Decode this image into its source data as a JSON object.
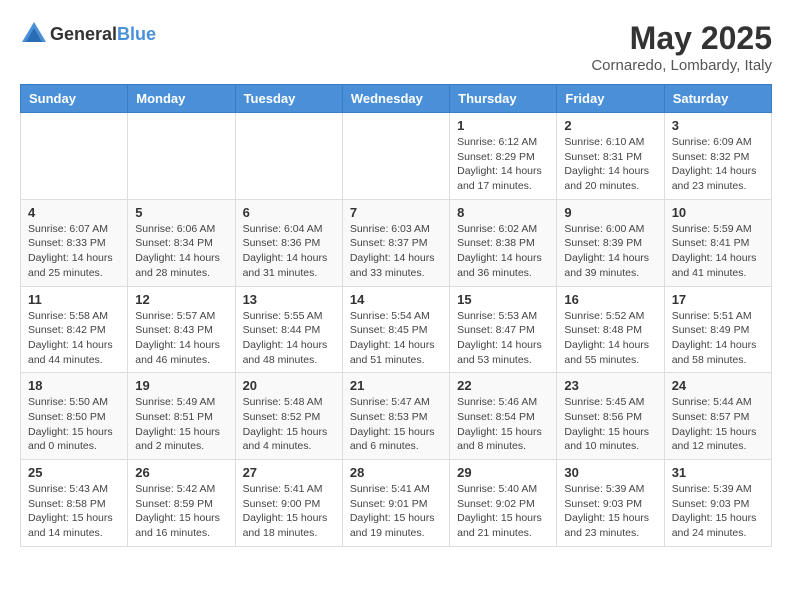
{
  "header": {
    "logo": {
      "general": "General",
      "blue": "Blue"
    },
    "month": "May 2025",
    "location": "Cornaredo, Lombardy, Italy"
  },
  "weekdays": [
    "Sunday",
    "Monday",
    "Tuesday",
    "Wednesday",
    "Thursday",
    "Friday",
    "Saturday"
  ],
  "weeks": [
    [
      {
        "day": "",
        "info": ""
      },
      {
        "day": "",
        "info": ""
      },
      {
        "day": "",
        "info": ""
      },
      {
        "day": "",
        "info": ""
      },
      {
        "day": "1",
        "info": "Sunrise: 6:12 AM\nSunset: 8:29 PM\nDaylight: 14 hours and 17 minutes."
      },
      {
        "day": "2",
        "info": "Sunrise: 6:10 AM\nSunset: 8:31 PM\nDaylight: 14 hours and 20 minutes."
      },
      {
        "day": "3",
        "info": "Sunrise: 6:09 AM\nSunset: 8:32 PM\nDaylight: 14 hours and 23 minutes."
      }
    ],
    [
      {
        "day": "4",
        "info": "Sunrise: 6:07 AM\nSunset: 8:33 PM\nDaylight: 14 hours and 25 minutes."
      },
      {
        "day": "5",
        "info": "Sunrise: 6:06 AM\nSunset: 8:34 PM\nDaylight: 14 hours and 28 minutes."
      },
      {
        "day": "6",
        "info": "Sunrise: 6:04 AM\nSunset: 8:36 PM\nDaylight: 14 hours and 31 minutes."
      },
      {
        "day": "7",
        "info": "Sunrise: 6:03 AM\nSunset: 8:37 PM\nDaylight: 14 hours and 33 minutes."
      },
      {
        "day": "8",
        "info": "Sunrise: 6:02 AM\nSunset: 8:38 PM\nDaylight: 14 hours and 36 minutes."
      },
      {
        "day": "9",
        "info": "Sunrise: 6:00 AM\nSunset: 8:39 PM\nDaylight: 14 hours and 39 minutes."
      },
      {
        "day": "10",
        "info": "Sunrise: 5:59 AM\nSunset: 8:41 PM\nDaylight: 14 hours and 41 minutes."
      }
    ],
    [
      {
        "day": "11",
        "info": "Sunrise: 5:58 AM\nSunset: 8:42 PM\nDaylight: 14 hours and 44 minutes."
      },
      {
        "day": "12",
        "info": "Sunrise: 5:57 AM\nSunset: 8:43 PM\nDaylight: 14 hours and 46 minutes."
      },
      {
        "day": "13",
        "info": "Sunrise: 5:55 AM\nSunset: 8:44 PM\nDaylight: 14 hours and 48 minutes."
      },
      {
        "day": "14",
        "info": "Sunrise: 5:54 AM\nSunset: 8:45 PM\nDaylight: 14 hours and 51 minutes."
      },
      {
        "day": "15",
        "info": "Sunrise: 5:53 AM\nSunset: 8:47 PM\nDaylight: 14 hours and 53 minutes."
      },
      {
        "day": "16",
        "info": "Sunrise: 5:52 AM\nSunset: 8:48 PM\nDaylight: 14 hours and 55 minutes."
      },
      {
        "day": "17",
        "info": "Sunrise: 5:51 AM\nSunset: 8:49 PM\nDaylight: 14 hours and 58 minutes."
      }
    ],
    [
      {
        "day": "18",
        "info": "Sunrise: 5:50 AM\nSunset: 8:50 PM\nDaylight: 15 hours and 0 minutes."
      },
      {
        "day": "19",
        "info": "Sunrise: 5:49 AM\nSunset: 8:51 PM\nDaylight: 15 hours and 2 minutes."
      },
      {
        "day": "20",
        "info": "Sunrise: 5:48 AM\nSunset: 8:52 PM\nDaylight: 15 hours and 4 minutes."
      },
      {
        "day": "21",
        "info": "Sunrise: 5:47 AM\nSunset: 8:53 PM\nDaylight: 15 hours and 6 minutes."
      },
      {
        "day": "22",
        "info": "Sunrise: 5:46 AM\nSunset: 8:54 PM\nDaylight: 15 hours and 8 minutes."
      },
      {
        "day": "23",
        "info": "Sunrise: 5:45 AM\nSunset: 8:56 PM\nDaylight: 15 hours and 10 minutes."
      },
      {
        "day": "24",
        "info": "Sunrise: 5:44 AM\nSunset: 8:57 PM\nDaylight: 15 hours and 12 minutes."
      }
    ],
    [
      {
        "day": "25",
        "info": "Sunrise: 5:43 AM\nSunset: 8:58 PM\nDaylight: 15 hours and 14 minutes."
      },
      {
        "day": "26",
        "info": "Sunrise: 5:42 AM\nSunset: 8:59 PM\nDaylight: 15 hours and 16 minutes."
      },
      {
        "day": "27",
        "info": "Sunrise: 5:41 AM\nSunset: 9:00 PM\nDaylight: 15 hours and 18 minutes."
      },
      {
        "day": "28",
        "info": "Sunrise: 5:41 AM\nSunset: 9:01 PM\nDaylight: 15 hours and 19 minutes."
      },
      {
        "day": "29",
        "info": "Sunrise: 5:40 AM\nSunset: 9:02 PM\nDaylight: 15 hours and 21 minutes."
      },
      {
        "day": "30",
        "info": "Sunrise: 5:39 AM\nSunset: 9:03 PM\nDaylight: 15 hours and 23 minutes."
      },
      {
        "day": "31",
        "info": "Sunrise: 5:39 AM\nSunset: 9:03 PM\nDaylight: 15 hours and 24 minutes."
      }
    ]
  ]
}
